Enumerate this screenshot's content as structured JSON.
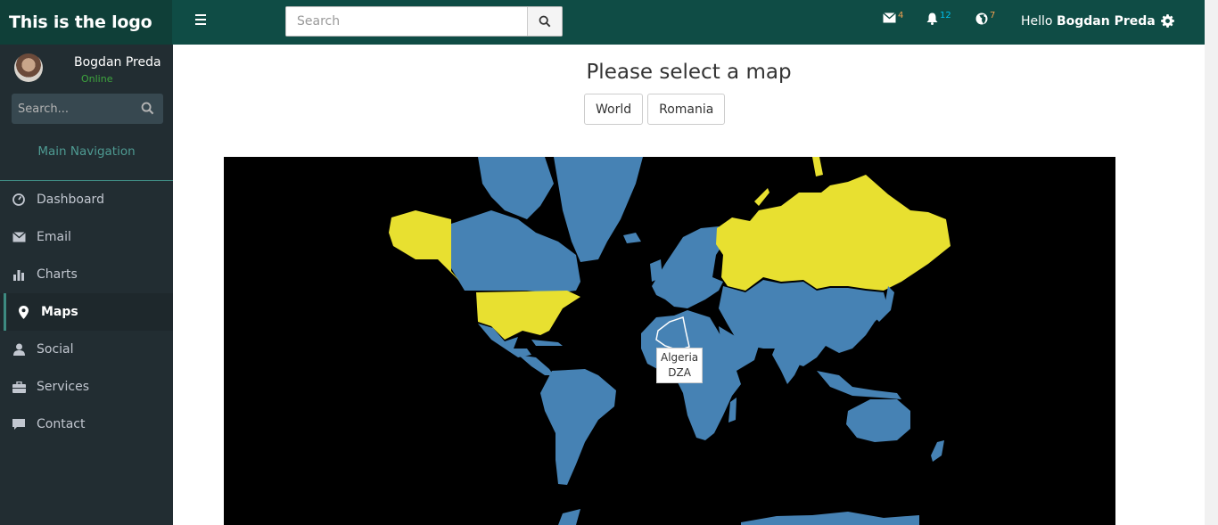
{
  "app": {
    "logo": "This is the logo"
  },
  "user": {
    "name": "Bogdan Preda",
    "status": "Online"
  },
  "sidebar": {
    "search_placeholder": "Search...",
    "nav_header": "Main Navigation",
    "items": [
      {
        "label": "Dashboard",
        "icon": "dashboard-icon",
        "active": false
      },
      {
        "label": "Email",
        "icon": "envelope-icon",
        "active": false
      },
      {
        "label": "Charts",
        "icon": "bar-chart-icon",
        "active": false
      },
      {
        "label": "Maps",
        "icon": "map-marker-icon",
        "active": true
      },
      {
        "label": "Social",
        "icon": "user-icon",
        "active": false
      },
      {
        "label": "Services",
        "icon": "briefcase-icon",
        "active": false
      },
      {
        "label": "Contact",
        "icon": "comment-icon",
        "active": false
      }
    ]
  },
  "header": {
    "search_placeholder": "Search",
    "notifications": {
      "mail_count": "4",
      "bell_count": "12",
      "globe_count": "7"
    },
    "greeting": "Hello",
    "user_name": "Bogdan Preda"
  },
  "main": {
    "title": "Please select a map",
    "buttons": [
      "World",
      "Romania"
    ],
    "tooltip": {
      "line1": "Algeria",
      "line2": "DZA"
    }
  },
  "colors": {
    "sidebar": "#222d32",
    "header": "#0f4c45",
    "land": "#4682b4",
    "highlight": "#e8e030",
    "ocean": "#000000"
  }
}
